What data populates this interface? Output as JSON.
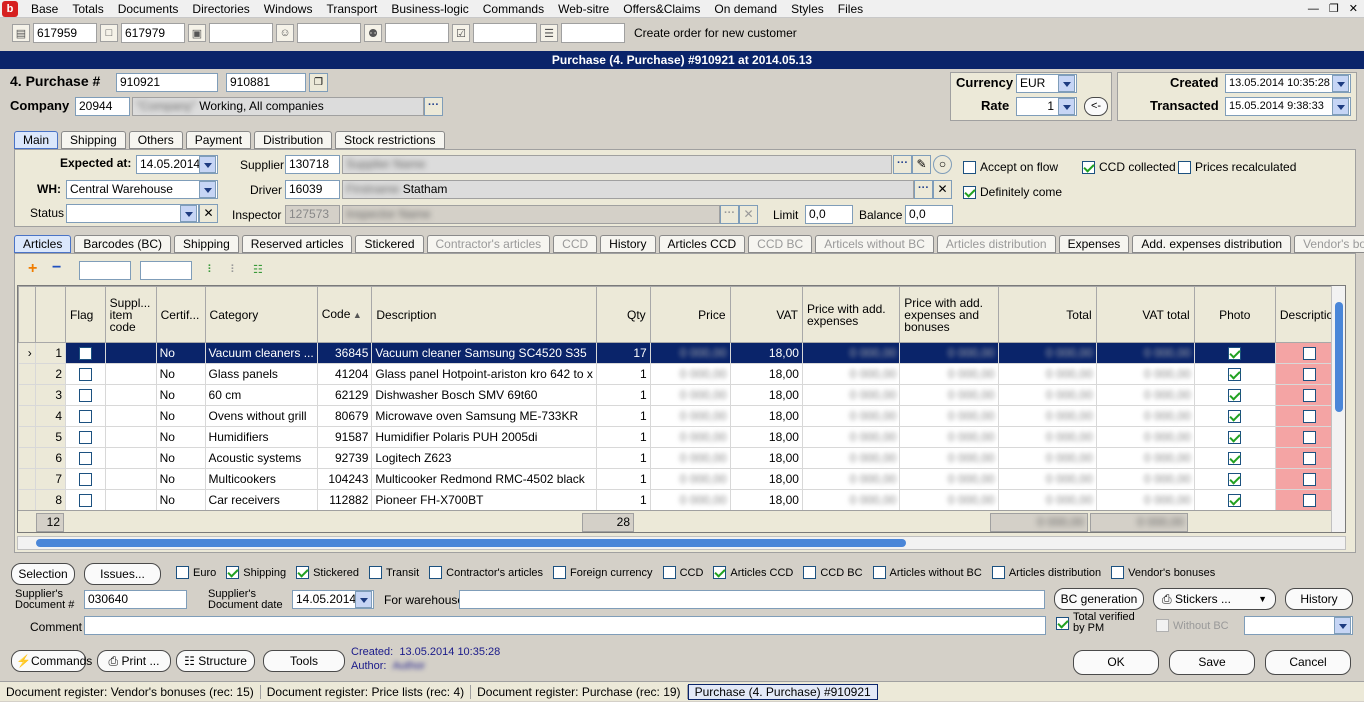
{
  "menubar": {
    "items": [
      "Base",
      "Totals",
      "Documents",
      "Directories",
      "Windows",
      "Transport",
      "Business-logic",
      "Commands",
      "Web-sitre",
      "Offers&Claims",
      "On demand",
      "Styles",
      "Files"
    ]
  },
  "toolbar": {
    "fields": [
      "617959",
      "617979",
      "",
      "",
      "",
      "",
      ""
    ],
    "create_order": "Create order for new customer"
  },
  "title": "Purchase (4. Purchase) #910921 at 2014.05.13",
  "header": {
    "purchase_label": "4. Purchase #",
    "purchase_no": "910921",
    "purchase_no2": "910881",
    "company_label": "Company",
    "company_code": "20944",
    "company_name_blur": "\"Company\"",
    "company_name": "Working, All companies",
    "currency_label": "Currency",
    "currency": "EUR",
    "rate_label": "Rate",
    "rate": "1",
    "rate_btn": "<-",
    "created_label": "Created",
    "created": "13.05.2014 10:35:28",
    "transacted_label": "Transacted",
    "transacted": "15.05.2014 9:38:33"
  },
  "main_tabs": [
    "Main",
    "Shipping",
    "Others",
    "Payment",
    "Distribution",
    "Stock restrictions"
  ],
  "main": {
    "expected_label": "Expected at:",
    "expected": "14.05.2014",
    "wh_label": "WH:",
    "wh": "Central Warehouse",
    "status_label": "Status",
    "status": "",
    "supplier_label": "Supplier",
    "supplier_code": "130718",
    "supplier_name": "Supplier Name",
    "driver_label": "Driver",
    "driver_code": "16039",
    "driver_first": "Firstname",
    "driver_name": "Statham",
    "inspector_label": "Inspector",
    "inspector_code": "127573",
    "inspector_name": "Inspector Name",
    "limit_label": "Limit",
    "limit": "0,0",
    "balance_label": "Balance",
    "balance": "0,0",
    "accept_on_flow": "Accept on flow",
    "ccd_collected": "CCD collected",
    "prices_recalculated": "Prices recalculated",
    "definitely_come": "Definitely come"
  },
  "article_tabs": [
    {
      "label": "Articles",
      "state": "active"
    },
    {
      "label": "Barcodes (BC)",
      "state": ""
    },
    {
      "label": "Shipping",
      "state": ""
    },
    {
      "label": "Reserved articles",
      "state": ""
    },
    {
      "label": "Stickered",
      "state": ""
    },
    {
      "label": "Contractor's articles",
      "state": "disabled"
    },
    {
      "label": "CCD",
      "state": "disabled"
    },
    {
      "label": "History",
      "state": ""
    },
    {
      "label": "Articles CCD",
      "state": ""
    },
    {
      "label": "CCD BC",
      "state": "disabled"
    },
    {
      "label": "Articels without BC",
      "state": "disabled"
    },
    {
      "label": "Articles distribution",
      "state": "disabled"
    },
    {
      "label": "Expenses",
      "state": ""
    },
    {
      "label": "Add. expenses distribution",
      "state": ""
    },
    {
      "label": "Vendor's bonuses",
      "state": "disabled"
    }
  ],
  "grid": {
    "columns": [
      "",
      "Flag",
      "Suppl... item code",
      "Certif...",
      "Category",
      "Code",
      "Description",
      "Qty",
      "Price",
      "VAT",
      "Price with add. expenses",
      "Price with add. expenses and bonuses",
      "Total",
      "VAT total",
      "Photo",
      "Description"
    ],
    "rows": [
      {
        "n": "1",
        "cert": "No",
        "cat": "Vacuum cleaners ...",
        "code": "36845",
        "desc": "Vacuum cleaner Samsung SC4520 S35",
        "qty": "17",
        "vat": "18,00"
      },
      {
        "n": "2",
        "cert": "No",
        "cat": "Glass panels",
        "code": "41204",
        "desc": "Glass panel Hotpoint-ariston kro 642 to x",
        "qty": "1",
        "vat": "18,00"
      },
      {
        "n": "3",
        "cert": "No",
        "cat": "60 cm",
        "code": "62129",
        "desc": "Dishwasher Bosch SMV 69t60",
        "qty": "1",
        "vat": "18,00"
      },
      {
        "n": "4",
        "cert": "No",
        "cat": "Ovens without grill",
        "code": "80679",
        "desc": "Microwave oven Samsung ME-733KR",
        "qty": "1",
        "vat": "18,00"
      },
      {
        "n": "5",
        "cert": "No",
        "cat": "Humidifiers",
        "code": "91587",
        "desc": "Humidifier Polaris PUH 2005di",
        "qty": "1",
        "vat": "18,00"
      },
      {
        "n": "6",
        "cert": "No",
        "cat": "Acoustic systems",
        "code": "92739",
        "desc": "Logitech Z623",
        "qty": "1",
        "vat": "18,00"
      },
      {
        "n": "7",
        "cert": "No",
        "cat": "Multicookers",
        "code": "104243",
        "desc": "Multicooker Redmond RMC-4502 black",
        "qty": "1",
        "vat": "18,00"
      },
      {
        "n": "8",
        "cert": "No",
        "cat": "Car receivers",
        "code": "112882",
        "desc": "Pioneer FH-X700BT",
        "qty": "1",
        "vat": "18,00"
      }
    ],
    "footer_count": "12",
    "footer_qty": "28",
    "blur_text": "0 000,00"
  },
  "bottom": {
    "selection": "Selection",
    "issues": "Issues...",
    "checks": [
      {
        "label": "Euro",
        "on": false
      },
      {
        "label": "Shipping",
        "on": true
      },
      {
        "label": "Stickered",
        "on": true
      },
      {
        "label": "Transit",
        "on": false
      },
      {
        "label": "Contractor's articles",
        "on": false
      },
      {
        "label": "Foreign currency",
        "on": false
      },
      {
        "label": "CCD",
        "on": false
      },
      {
        "label": "Articles CCD",
        "on": true
      },
      {
        "label": "CCD BC",
        "on": false
      },
      {
        "label": "Articles without BC",
        "on": false
      },
      {
        "label": "Articles distribution",
        "on": false
      },
      {
        "label": "Vendor's bonuses",
        "on": false
      }
    ],
    "supplier_doc_label": "Supplier's Document #",
    "supplier_doc": "030640",
    "supplier_doc_date_label": "Supplier's Document date",
    "supplier_doc_date": "14.05.2014",
    "for_warehouse": "For warehouse",
    "bc_generation": "BC generation",
    "stickers": "Stickers ...",
    "history": "History",
    "comment_label": "Comment",
    "total_verified": "Total verified by PM",
    "without_bc": "Without BC",
    "commands": "Commands",
    "print": "Print ...",
    "structure": "Structure",
    "tools": "Tools",
    "created_label": "Created:",
    "created": "13.05.2014 10:35:28",
    "author_label": "Author:",
    "author": "Author",
    "ok": "OK",
    "save": "Save",
    "cancel": "Cancel"
  },
  "statusbar": [
    "Document register: Vendor's bonuses (rec: 15)",
    "Document register: Price lists (rec: 4)",
    "Document register: Purchase (rec: 19)",
    "Purchase (4. Purchase) #910921"
  ]
}
